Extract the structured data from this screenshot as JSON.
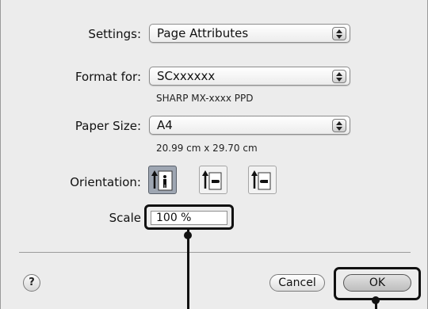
{
  "settings": {
    "label": "Settings:",
    "value": "Page Attributes"
  },
  "format_for": {
    "label": "Format for:",
    "value": "SCxxxxxx",
    "subtitle": "SHARP MX-xxxx PPD"
  },
  "paper_size": {
    "label": "Paper Size:",
    "value": "A4",
    "dimensions": "20.99 cm x 29.70 cm"
  },
  "orientation": {
    "label": "Orientation:",
    "options": [
      {
        "icon": "portrait-orientation-icon",
        "selected": true
      },
      {
        "icon": "landscape-left-orientation-icon",
        "selected": false
      },
      {
        "icon": "landscape-right-orientation-icon",
        "selected": false
      }
    ]
  },
  "scale": {
    "label": "Scale",
    "value": "100 %"
  },
  "buttons": {
    "help": "?",
    "cancel": "Cancel",
    "ok": "OK"
  },
  "colors": {
    "dialog_bg": "#ececec",
    "callout": "#111111",
    "selected_orientation": "#9ea6b2"
  }
}
